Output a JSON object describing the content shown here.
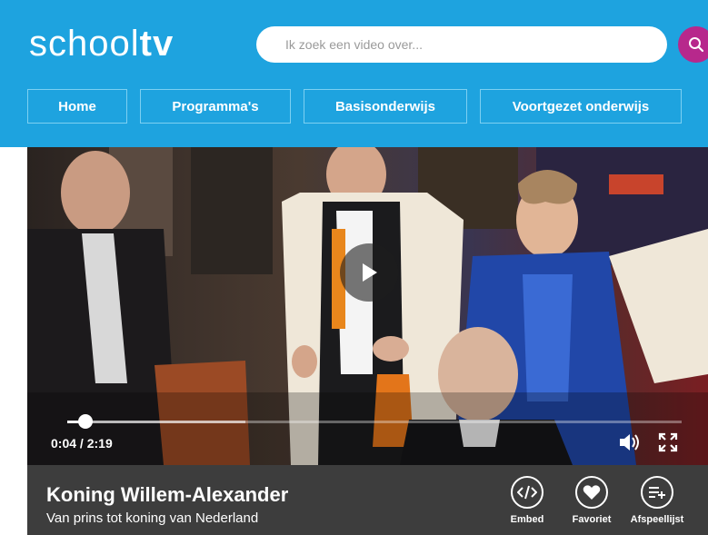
{
  "header": {
    "logo": {
      "light": "school",
      "bold": "tv"
    },
    "search_placeholder": "Ik zoek een video over...",
    "search_icon": "search-icon",
    "colors": {
      "background": "#1ea3df",
      "search_button": "#b7288c"
    }
  },
  "nav": {
    "items": [
      {
        "label": "Home"
      },
      {
        "label": "Programma's"
      },
      {
        "label": "Basisonderwijs"
      },
      {
        "label": "Voortgezet onderwijs"
      }
    ]
  },
  "player": {
    "current_time": "0:04",
    "separator": "/",
    "duration": "2:19",
    "progress_fraction": 0.029,
    "buffered_fraction": 0.29,
    "icons": [
      "play-icon",
      "volume-icon",
      "fullscreen-icon"
    ]
  },
  "info": {
    "title": "Koning Willem-Alexander",
    "subtitle": "Van prins tot koning van Nederland",
    "actions": [
      {
        "label": "Embed",
        "icon": "embed-icon"
      },
      {
        "label": "Favoriet",
        "icon": "heart-icon"
      },
      {
        "label": "Afspeellijst",
        "icon": "playlist-add-icon"
      }
    ]
  }
}
